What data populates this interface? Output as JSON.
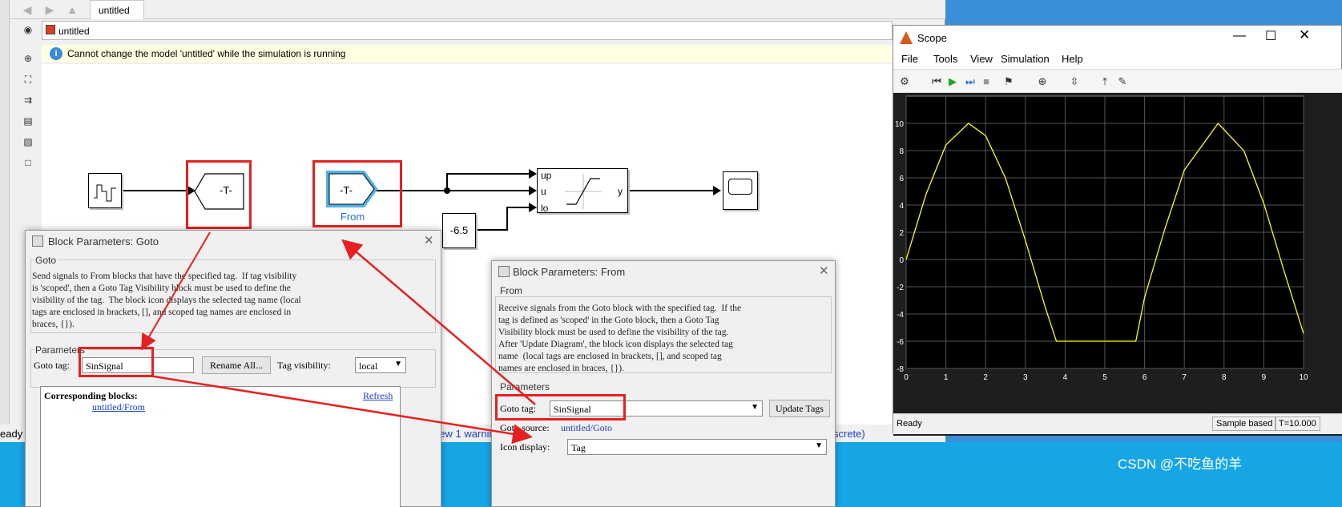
{
  "simulink": {
    "tab_label": "untitled",
    "address": "untitled",
    "info_message": "Cannot change the model 'untitled' while the simulation is running",
    "status_left": "eady",
    "status_warning": "View 1 warnin",
    "status_right": "screte)",
    "blocks": {
      "goto_label": "-T-",
      "from_label": "-T-",
      "from_caption": "From",
      "constant_value": "-6.5",
      "saturation_ports": [
        "up",
        "u",
        "lo"
      ],
      "saturation_out": "y"
    }
  },
  "scope": {
    "title": "Scope",
    "menu": [
      "File",
      "Tools",
      "View",
      "Simulation",
      "Help"
    ],
    "status_ready": "Ready",
    "status_sample": "Sample based",
    "status_time": "T=10.000",
    "colors": {
      "background": "#000000",
      "trace": "#ffff00",
      "grid": "#555555"
    }
  },
  "chart_data": {
    "type": "line",
    "title": "",
    "xlabel": "",
    "ylabel": "",
    "xlim": [
      0,
      10
    ],
    "ylim": [
      -8,
      12
    ],
    "x_ticks": [
      0,
      1,
      2,
      3,
      4,
      5,
      6,
      7,
      8,
      9,
      10
    ],
    "y_ticks": [
      -8,
      -6,
      -4,
      -2,
      0,
      2,
      4,
      6,
      8,
      10
    ],
    "grid": true,
    "series": [
      {
        "x": [
          0,
          0.5,
          1.0,
          1.57,
          2.0,
          2.5,
          3.0,
          3.5,
          3.78,
          4.0,
          4.5,
          5.0,
          5.5,
          5.78,
          6.0,
          6.5,
          7.0,
          7.85,
          8.5,
          9.0,
          9.5,
          10.0
        ],
        "y": [
          0,
          4.79,
          8.41,
          10.0,
          9.09,
          5.98,
          1.41,
          -3.51,
          -6.0,
          -6.0,
          -6.0,
          -6.0,
          -6.0,
          -6.0,
          -2.79,
          2.15,
          6.57,
          10.0,
          7.98,
          4.12,
          -0.75,
          -5.44
        ]
      }
    ]
  },
  "goto_dialog": {
    "title": "Block Parameters: Goto",
    "group": "Goto",
    "description": "Send signals to From blocks that have the specified tag.  If tag visibility\nis 'scoped', then a Goto Tag Visibility block must be used to define the\nvisibility of the tag.  The block icon displays the selected tag name (local\ntags are enclosed in brackets, [], and scoped tag names are enclosed in\nbraces, {}).",
    "params_label": "Parameters",
    "goto_tag_label": "Goto tag:",
    "goto_tag_value": "SinSignal",
    "rename_button": "Rename All...",
    "visibility_label": "Tag visibility:",
    "visibility_value": "local",
    "corresponding_label": "Corresponding blocks:",
    "corresponding_link": "untitled/From",
    "refresh_link": "Refresh"
  },
  "from_dialog": {
    "title": "Block Parameters: From",
    "group": "From",
    "description": "Receive signals from the Goto block with the specified tag.  If the\ntag is defined as 'scoped' in the Goto block, then a Goto Tag\nVisibility block must be used to define the visibility of the tag.\nAfter 'Update Diagram', the block icon displays the selected tag\nname  (local tags are enclosed in brackets, [], and scoped tag\nnames are enclosed in braces, {}).",
    "params_label": "Parameters",
    "goto_tag_label": "Goto tag:",
    "goto_tag_value": "SinSignal",
    "update_button": "Update Tags",
    "source_label": "Goto source:",
    "source_value": "untitled/Goto",
    "icon_display_label": "Icon display:",
    "icon_display_value": "Tag"
  },
  "watermark": "CSDN @不吃鱼的羊"
}
